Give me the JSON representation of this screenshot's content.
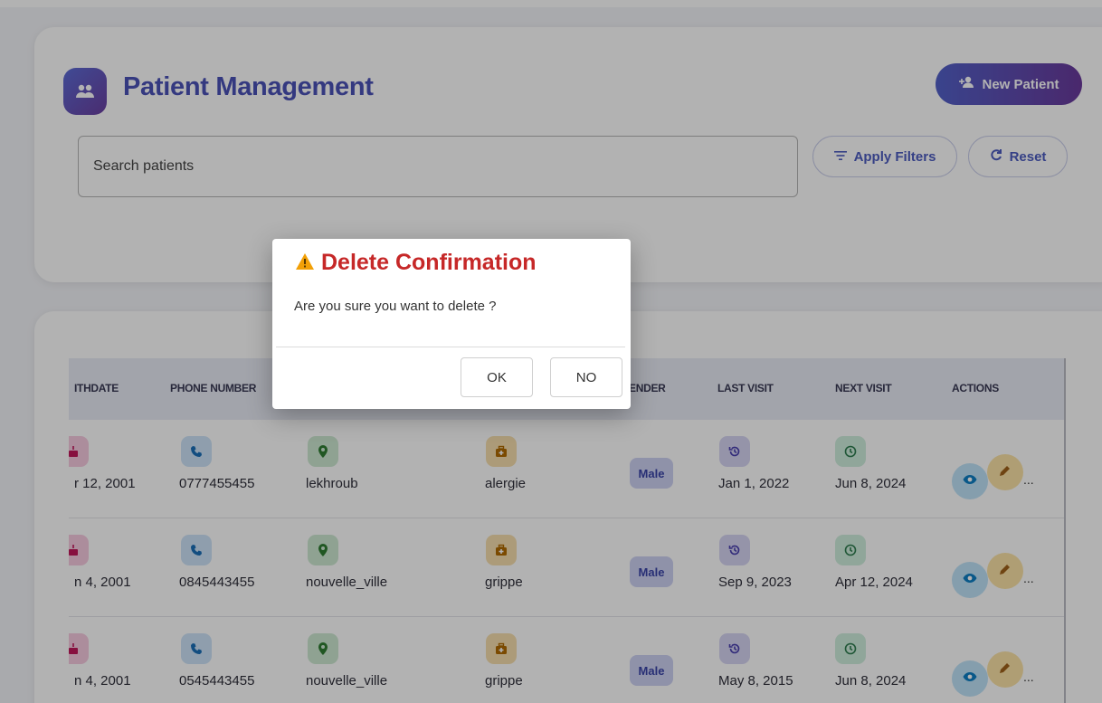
{
  "header": {
    "title": "Patient Management",
    "new_patient_label": "New Patient"
  },
  "search": {
    "placeholder": "Search patients"
  },
  "filters": {
    "apply_label": "Apply Filters",
    "reset_label": "Reset"
  },
  "table": {
    "columns": {
      "birthdate": "ITHDATE",
      "phone": "PHONE NUMBER",
      "gender": "GENDER",
      "last_visit": "LAST VISIT",
      "next_visit": "NEXT VISIT",
      "actions": "ACTIONS"
    },
    "rows": [
      {
        "birthdate": "r 12, 2001",
        "phone": "0777455455",
        "address": "lekhroub",
        "condition": "alergie",
        "gender": "Male",
        "last_visit": "Jan 1, 2022",
        "next_visit": "Jun 8, 2024"
      },
      {
        "birthdate": "n 4, 2001",
        "phone": "0845443455",
        "address": "nouvelle_ville",
        "condition": "grippe",
        "gender": "Male",
        "last_visit": "Sep 9, 2023",
        "next_visit": "Apr 12, 2024"
      },
      {
        "birthdate": "n 4, 2001",
        "phone": "0545443455",
        "address": "nouvelle_ville",
        "condition": "grippe",
        "gender": "Male",
        "last_visit": "May 8, 2015",
        "next_visit": "Jun 8, 2024"
      }
    ],
    "more_label": "..."
  },
  "dialog": {
    "title": "Delete Confirmation",
    "message": "Are you sure you want to delete ?",
    "ok_label": "OK",
    "no_label": "NO"
  },
  "colors": {
    "accent": "#4b52b8",
    "danger": "#c62828",
    "warning": "#f2a007"
  }
}
